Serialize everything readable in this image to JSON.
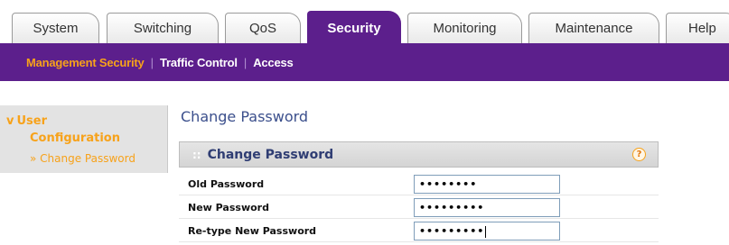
{
  "tabs": [
    {
      "label": "System"
    },
    {
      "label": "Switching"
    },
    {
      "label": "QoS"
    },
    {
      "label": "Security",
      "active": true
    },
    {
      "label": "Monitoring"
    },
    {
      "label": "Maintenance"
    },
    {
      "label": "Help"
    }
  ],
  "subnav": [
    {
      "label": "Management Security",
      "active": true
    },
    {
      "label": "Traffic Control"
    },
    {
      "label": "Access"
    }
  ],
  "subnav_separator": "|",
  "sidebar": {
    "arrow": "v",
    "section_line1": "User",
    "section_line2": "Configuration",
    "item": "» Change Password"
  },
  "page_title": "Change Password",
  "panel": {
    "grip": "::",
    "title": "Change Password",
    "help_glyph": "?"
  },
  "form": {
    "rows": [
      {
        "label": "Old Password",
        "value": "••••••••"
      },
      {
        "label": "New Password",
        "value": "•••••••••"
      },
      {
        "label": "Re-type New Password",
        "value": "•••••••••"
      }
    ]
  },
  "colors": {
    "brand_purple": "#5c1f8c",
    "accent_orange": "#f7a21a",
    "title_blue": "#3b4f8c"
  }
}
